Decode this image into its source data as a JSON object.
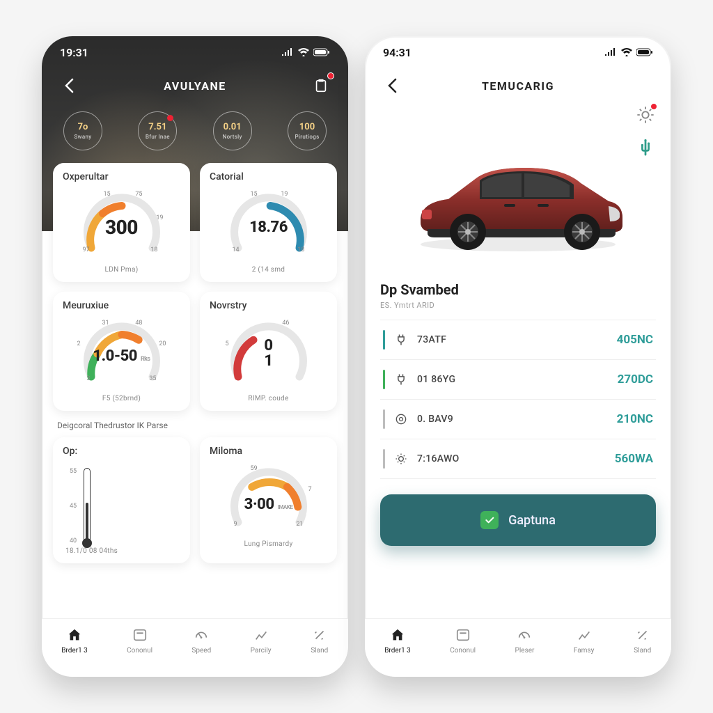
{
  "colors": {
    "teal": "#2d6b70",
    "tealText": "#2f9d99",
    "amber": "#f0a738",
    "orange": "#f07f2d",
    "blue": "#2e8bb0",
    "red": "#d23b3b",
    "green": "#3fb15a",
    "gray": "#d0d0d0"
  },
  "left": {
    "status_time": "19:31",
    "title": "AVULYANE",
    "chips": [
      {
        "value": "7o",
        "label": "Swany"
      },
      {
        "value": "7.51",
        "label": "Bfur lnae",
        "dot": true
      },
      {
        "value": "0.01",
        "label": "Nortsly"
      },
      {
        "value": "100",
        "label": "Pirutiogs"
      }
    ],
    "cards": {
      "oxperultar": {
        "label": "Oxperultar",
        "value": "300",
        "foot": "LDN  Pma)",
        "ticks": [
          "15",
          "75",
          "19",
          "18",
          "97"
        ]
      },
      "catorial": {
        "label": "Catorial",
        "value": "18.76",
        "foot": "2  (14 smd",
        "ticks": [
          "15",
          "19",
          "18",
          "14"
        ]
      },
      "meuruxiue": {
        "label": "Meuruxiue",
        "value": "1.0-50",
        "value_suffix": "Rks",
        "foot": "F5 (52brnd)",
        "ticks": [
          "31",
          "48",
          "2",
          "20",
          "3",
          "35"
        ]
      },
      "novrstry": {
        "label": "Novrstry",
        "value_top": "0",
        "value_bot": "1",
        "foot": "RIMP. coude",
        "ticks": [
          "46",
          "5"
        ]
      },
      "op": {
        "label": "Op:",
        "foot": "18.1/0 08 04ths",
        "scale": [
          "55",
          "45",
          "40"
        ]
      },
      "miloma": {
        "label": "Miloma",
        "value": "3·00",
        "value_suffix": "IMAKE",
        "foot": "Lung Pismardy",
        "ticks": [
          "59",
          "7",
          "9",
          "21"
        ]
      }
    },
    "section_caption": "Deigcoral Thedrustor IK Parse",
    "tabs": [
      {
        "label": "Brder1 3",
        "icon": "home"
      },
      {
        "label": "Cononul",
        "icon": "panel"
      },
      {
        "label": "Speed",
        "icon": "gauge"
      },
      {
        "label": "Parcily",
        "icon": "chart"
      },
      {
        "label": "Sland",
        "icon": "wand"
      }
    ]
  },
  "right": {
    "status_time": "94:31",
    "title": "TEMUCARIG",
    "section_title": "Dp Svambed",
    "section_sub": "ES. Ymtrt ARID",
    "stats": [
      {
        "icon": "plug",
        "label": "73ATF",
        "value": "405NC",
        "bar": "#2f9d99",
        "val_color": "#2f9d99"
      },
      {
        "icon": "plug",
        "label": "01 86YG",
        "value": "270DC",
        "bar": "#3fb15a",
        "val_color": "#2f9d99"
      },
      {
        "icon": "target",
        "label": "0. BAV9",
        "value": "210NC",
        "bar": "#bdbdbd",
        "val_color": "#2f9d99"
      },
      {
        "icon": "sun",
        "label": "7:16AWO",
        "value": "560WA",
        "bar": "#bdbdbd",
        "val_color": "#2f9d99"
      }
    ],
    "cta_label": "Gaptuna",
    "tabs": [
      {
        "label": "Brder1 3",
        "icon": "home"
      },
      {
        "label": "Cononul",
        "icon": "panel"
      },
      {
        "label": "Pleser",
        "icon": "gauge"
      },
      {
        "label": "Famsy",
        "icon": "chart"
      },
      {
        "label": "Sland",
        "icon": "wand"
      }
    ]
  }
}
